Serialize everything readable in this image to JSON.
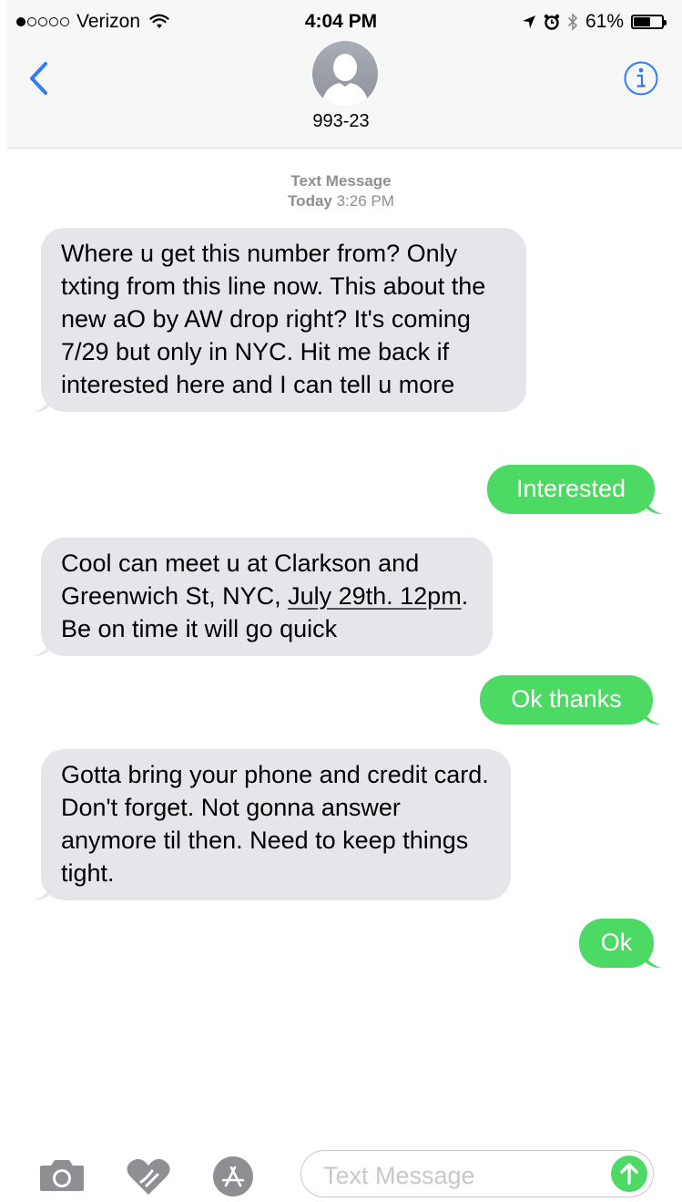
{
  "status_bar": {
    "carrier": "Verizon",
    "signal_bars_filled": 1,
    "signal_bars_total": 5,
    "time": "4:04 PM",
    "battery": "61%",
    "battery_level": 0.61,
    "icons": [
      "wifi-icon",
      "location-icon",
      "alarm-icon",
      "bluetooth-icon",
      "battery-icon"
    ]
  },
  "header": {
    "contact_name": "993-23",
    "back_icon": "chevron-left-icon",
    "info_icon": "info-icon",
    "accent": "#2f7cf6"
  },
  "thread": {
    "service": "Text Message",
    "day": "Today",
    "time": "3:26 PM"
  },
  "messages": [
    {
      "from": "them",
      "text": "Where u get this number from? Only txting from this line now. This about the new aO by AW drop right? It's coming 7/29 but only in NYC. Hit me back if interested here and I can tell u more"
    },
    {
      "from": "me",
      "text": "Interested"
    },
    {
      "from": "them",
      "text_before": "Cool can meet u at Clarkson and Greenwich St, NYC, ",
      "link_text": "July 29th. 12pm",
      "text_after": ". Be on time it will go quick"
    },
    {
      "from": "me",
      "text": "Ok thanks"
    },
    {
      "from": "them",
      "text": "Gotta bring your phone and credit card. Don't forget. Not gonna answer anymore til then. Need to keep things tight."
    },
    {
      "from": "me",
      "text": "Ok"
    }
  ],
  "input_bar": {
    "placeholder": "Text Message",
    "tools": [
      "camera-icon",
      "digital-touch-icon",
      "app-store-icon"
    ],
    "send_icon": "send-arrow-icon"
  },
  "colors": {
    "incoming_bubble": "#e5e5ea",
    "outgoing_bubble": "#4cd964",
    "timestamp": "#8e8e93"
  }
}
